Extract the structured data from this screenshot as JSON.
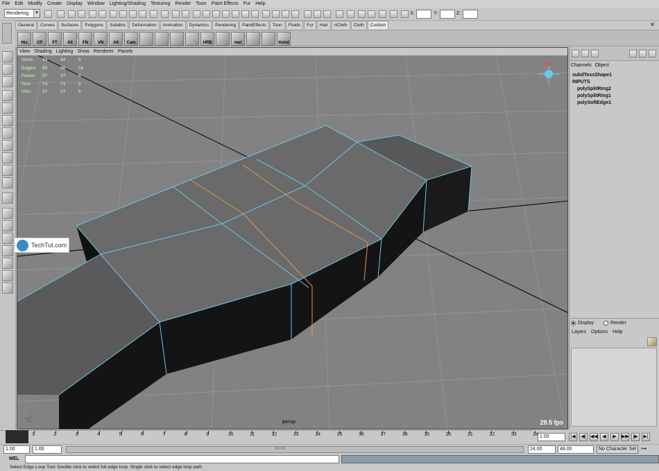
{
  "menubar": [
    "File",
    "Edit",
    "Modify",
    "Create",
    "Display",
    "Window",
    "Lighting/Shading",
    "Texturing",
    "Render",
    "Toon",
    "Paint Effects",
    "Fur",
    "Help"
  ],
  "statusline": {
    "mode": "Rendering",
    "x_label": "X:",
    "y_label": "Y:",
    "z_label": "Z:"
  },
  "shelf_tabs": [
    "General",
    "Curves",
    "Surfaces",
    "Polygons",
    "Subdivs",
    "Deformation",
    "Animation",
    "Dynamics",
    "Rendering",
    "PaintEffects",
    "Toon",
    "Fluids",
    "Fur",
    "Hair",
    "nCloth",
    "Cloth",
    "Custom"
  ],
  "shelf_active_tab": "Custom",
  "shelf_buttons": [
    "His",
    "CP",
    "FT",
    "All",
    "FN",
    "VN",
    "All",
    "Cam",
    "",
    "",
    "",
    "",
    "HRB",
    "",
    "mel",
    "",
    "",
    "Hshd"
  ],
  "viewport": {
    "menu": [
      "View",
      "Shading",
      "Lighting",
      "Show",
      "Renderer",
      "Panels"
    ],
    "hud": [
      {
        "label": "Verts:",
        "a": "44",
        "b": "44",
        "c": "0"
      },
      {
        "label": "Edges:",
        "a": "88",
        "b": "88",
        "c": "16"
      },
      {
        "label": "Faces:",
        "a": "37",
        "b": "37",
        "c": "0"
      },
      {
        "label": "Tris:",
        "a": "74",
        "b": "74",
        "c": "0"
      },
      {
        "label": "UVs:",
        "a": "57",
        "b": "57",
        "c": "0"
      }
    ],
    "fps": "29.5 fps",
    "camera": "persp"
  },
  "watermark": "TechTut.com",
  "channelbox": {
    "menu": [
      "Channels",
      "Object"
    ],
    "shape": "subdTessShape1",
    "inputs_label": "INPUTS",
    "inputs": [
      "polySplitRing2",
      "polySplitRing1",
      "polySoftEdge1"
    ]
  },
  "layers": {
    "display": "Display",
    "render": "Render",
    "menu": [
      "Layers",
      "Options",
      "Help"
    ]
  },
  "timeline": {
    "ticks": [
      "1",
      "2",
      "3",
      "4",
      "5",
      "6",
      "7",
      "8",
      "9",
      "10",
      "11",
      "12",
      "13",
      "14",
      "15",
      "16",
      "17",
      "18",
      "19",
      "20",
      "21",
      "22",
      "23",
      "24"
    ],
    "current": "1.00",
    "range_start": "1.00",
    "range_start2": "1.00",
    "range_center": "24.00",
    "range_end": "24.00",
    "range_end2": "48.00",
    "char_set": "No Character Set"
  },
  "cmdline": {
    "label": "MEL"
  },
  "helpline": "Select Edge Loop Tool: Double click to select full edge loop. Single click to select edge loop path"
}
